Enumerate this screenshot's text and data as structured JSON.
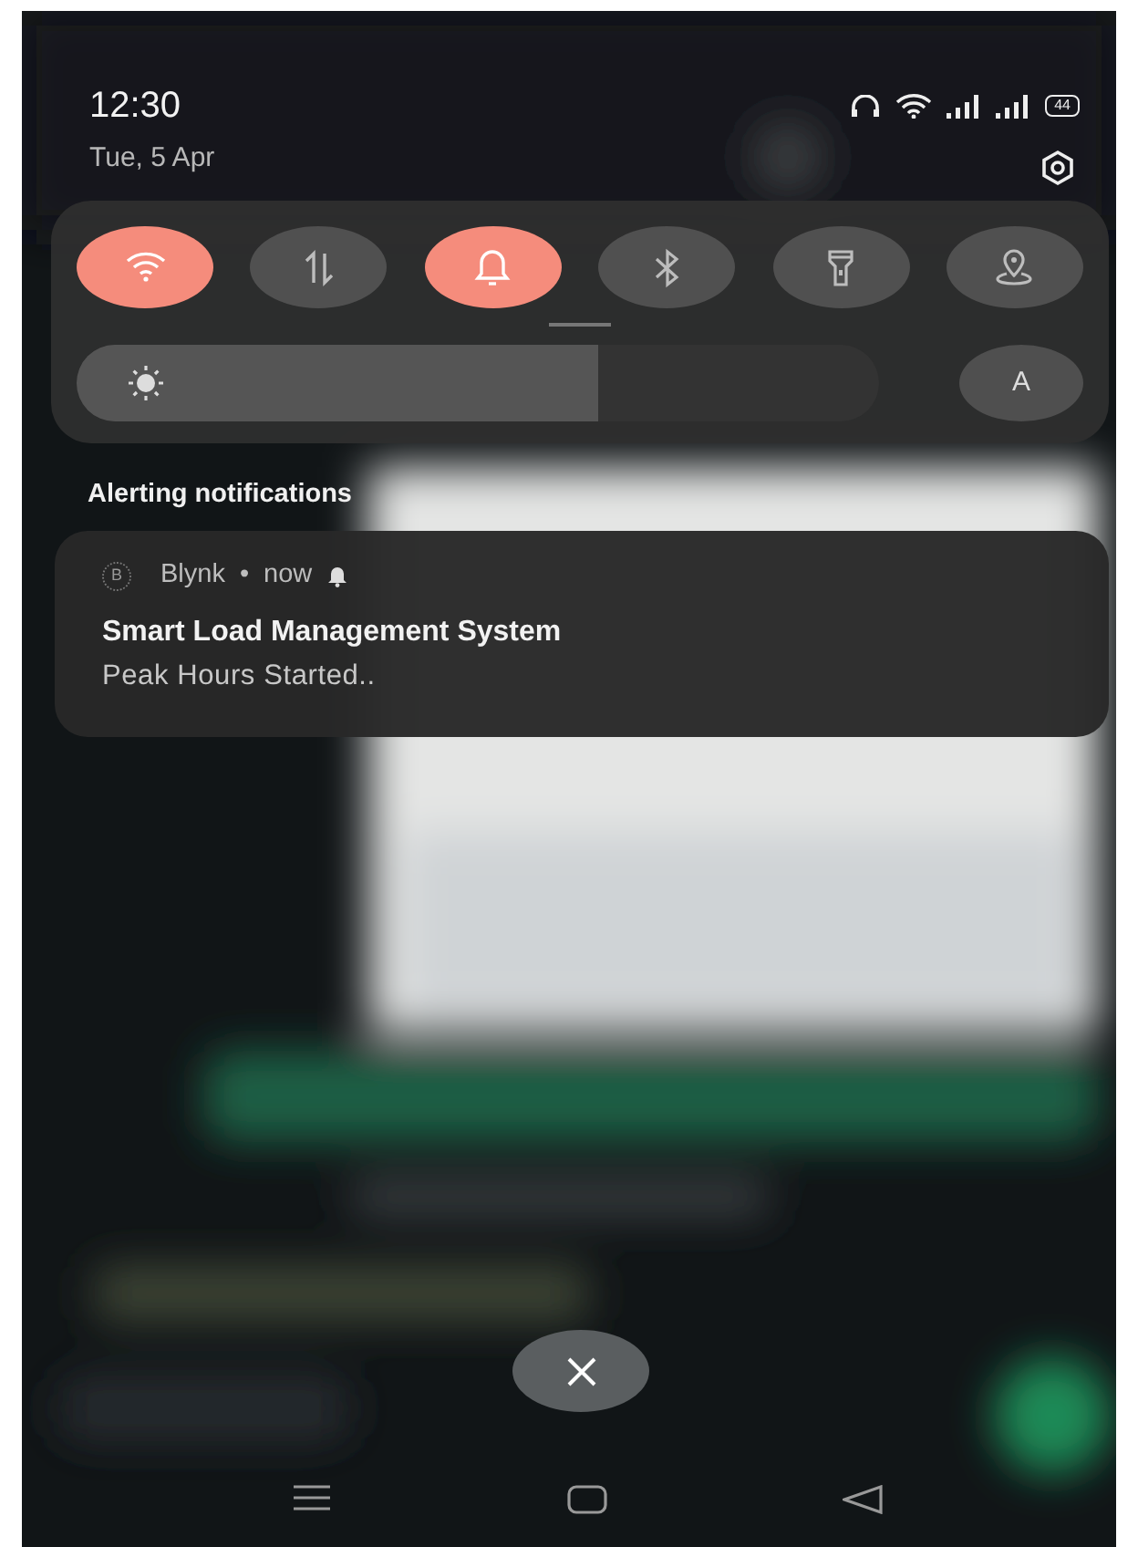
{
  "status_bar": {
    "time": "12:30",
    "date": "Tue, 5 Apr",
    "battery": "44"
  },
  "quick_tiles": [
    {
      "kind": "wifi",
      "on": true
    },
    {
      "kind": "data",
      "on": false
    },
    {
      "kind": "bell",
      "on": true
    },
    {
      "kind": "bluetooth",
      "on": false
    },
    {
      "kind": "torch",
      "on": false
    },
    {
      "kind": "location",
      "on": false
    }
  ],
  "brightness": {
    "level": 0.65,
    "auto_label": "A"
  },
  "section_title": "Alerting notifications",
  "notification": {
    "app_icon": "B",
    "app": "Blynk",
    "separator": "•",
    "time": "now",
    "title": "Smart Load Management System",
    "text": "Peak Hours Started.."
  }
}
